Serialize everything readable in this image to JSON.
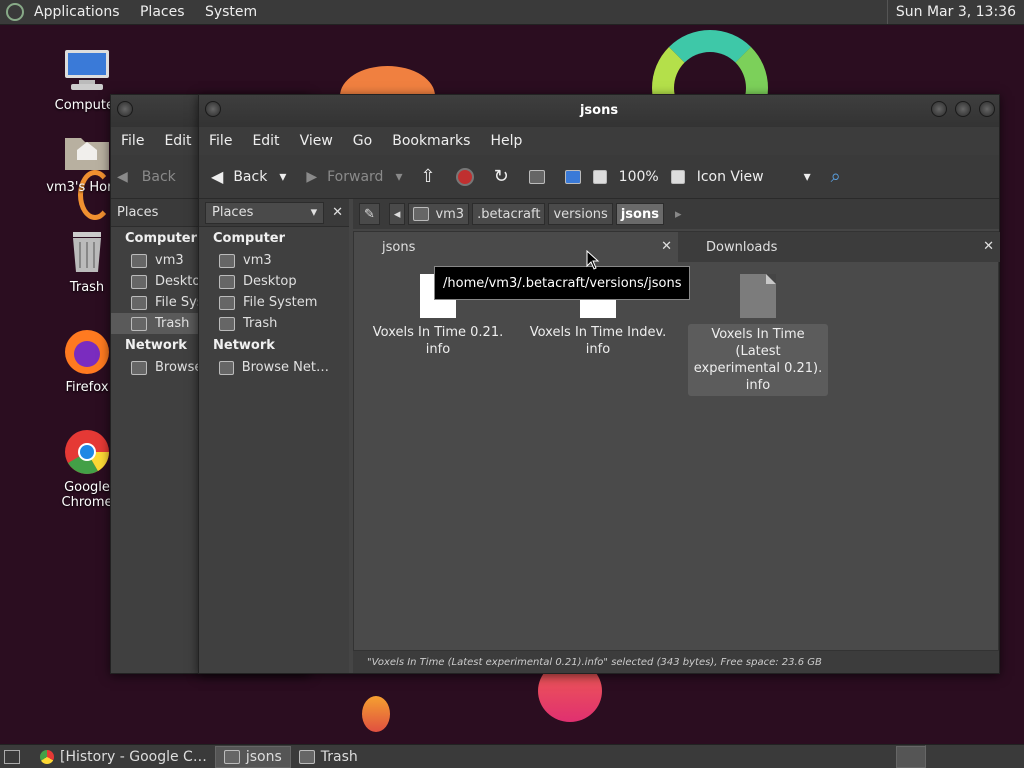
{
  "top_panel": {
    "menus": [
      "Applications",
      "Places",
      "System"
    ],
    "clock": "Sun Mar  3, 13:36"
  },
  "desktop_icons": [
    "Computer",
    "vm3's Home",
    "Trash",
    "Firefox",
    "Google Chrome"
  ],
  "back_window": {
    "menu": [
      "File",
      "Edit"
    ],
    "toolbar": {
      "back": "Back"
    },
    "places_label": "Places",
    "sections": [
      {
        "title": "Computer",
        "items": [
          "vm3",
          "Desktop",
          "File System",
          "Trash"
        ]
      },
      {
        "title": "Network",
        "items": [
          "Browse Network"
        ]
      }
    ]
  },
  "window": {
    "title": "jsons",
    "menu": [
      "File",
      "Edit",
      "View",
      "Go",
      "Bookmarks",
      "Help"
    ],
    "toolbar": {
      "back": "Back",
      "forward": "Forward",
      "zoom": "100%",
      "view_mode": "Icon View"
    },
    "places_label": "Places",
    "sections": [
      {
        "title": "Computer",
        "items": [
          "vm3",
          "Desktop",
          "File System",
          "Trash"
        ]
      },
      {
        "title": "Network",
        "items": [
          "Browse Net…"
        ]
      }
    ],
    "breadcrumbs": [
      "vm3",
      ".betacraft",
      "versions",
      "jsons"
    ],
    "tabs": [
      "jsons",
      "Downloads"
    ],
    "tooltip": "/home/vm3/.betacraft/versions/jsons",
    "files": [
      {
        "name": "Voxels In Time 0.21.\ninfo",
        "selected": false
      },
      {
        "name": "Voxels In Time Indev.\ninfo",
        "selected": false
      },
      {
        "name": "Voxels In Time (Latest\nexperimental 0.21).\ninfo",
        "selected": true
      }
    ],
    "status": "\"Voxels In Time (Latest experimental 0.21).info\" selected (343 bytes), Free space: 23.6 GB"
  },
  "taskbar": {
    "tasks": [
      "[History - Google C…",
      "jsons",
      "Trash"
    ]
  }
}
